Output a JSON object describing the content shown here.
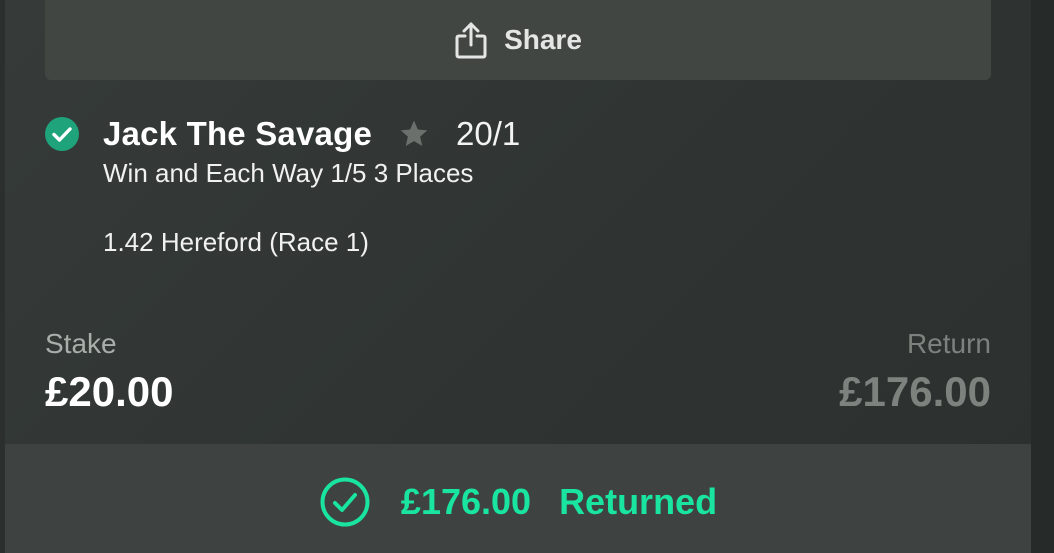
{
  "share": {
    "label": "Share",
    "icon": "share-icon"
  },
  "selection": {
    "name": "Jack The Savage",
    "odds": "20/1",
    "market": "Win and Each Way 1/5 3 Places",
    "event": "1.42 Hereford (Race 1)",
    "status_icon": "check-circle-icon",
    "favourite_icon": "star-icon"
  },
  "stake": {
    "label": "Stake",
    "value": "£20.00"
  },
  "return": {
    "label": "Return",
    "value": "£176.00"
  },
  "result": {
    "amount": "£176.00",
    "status": "Returned",
    "icon": "check-circle-outline-icon"
  },
  "colors": {
    "accent_green": "#19e5a0",
    "check_green": "#1fa37a",
    "card_bg": "#333836",
    "share_bg": "#414643",
    "footer_bg": "#3e4341",
    "muted_text": "#7d827f"
  }
}
